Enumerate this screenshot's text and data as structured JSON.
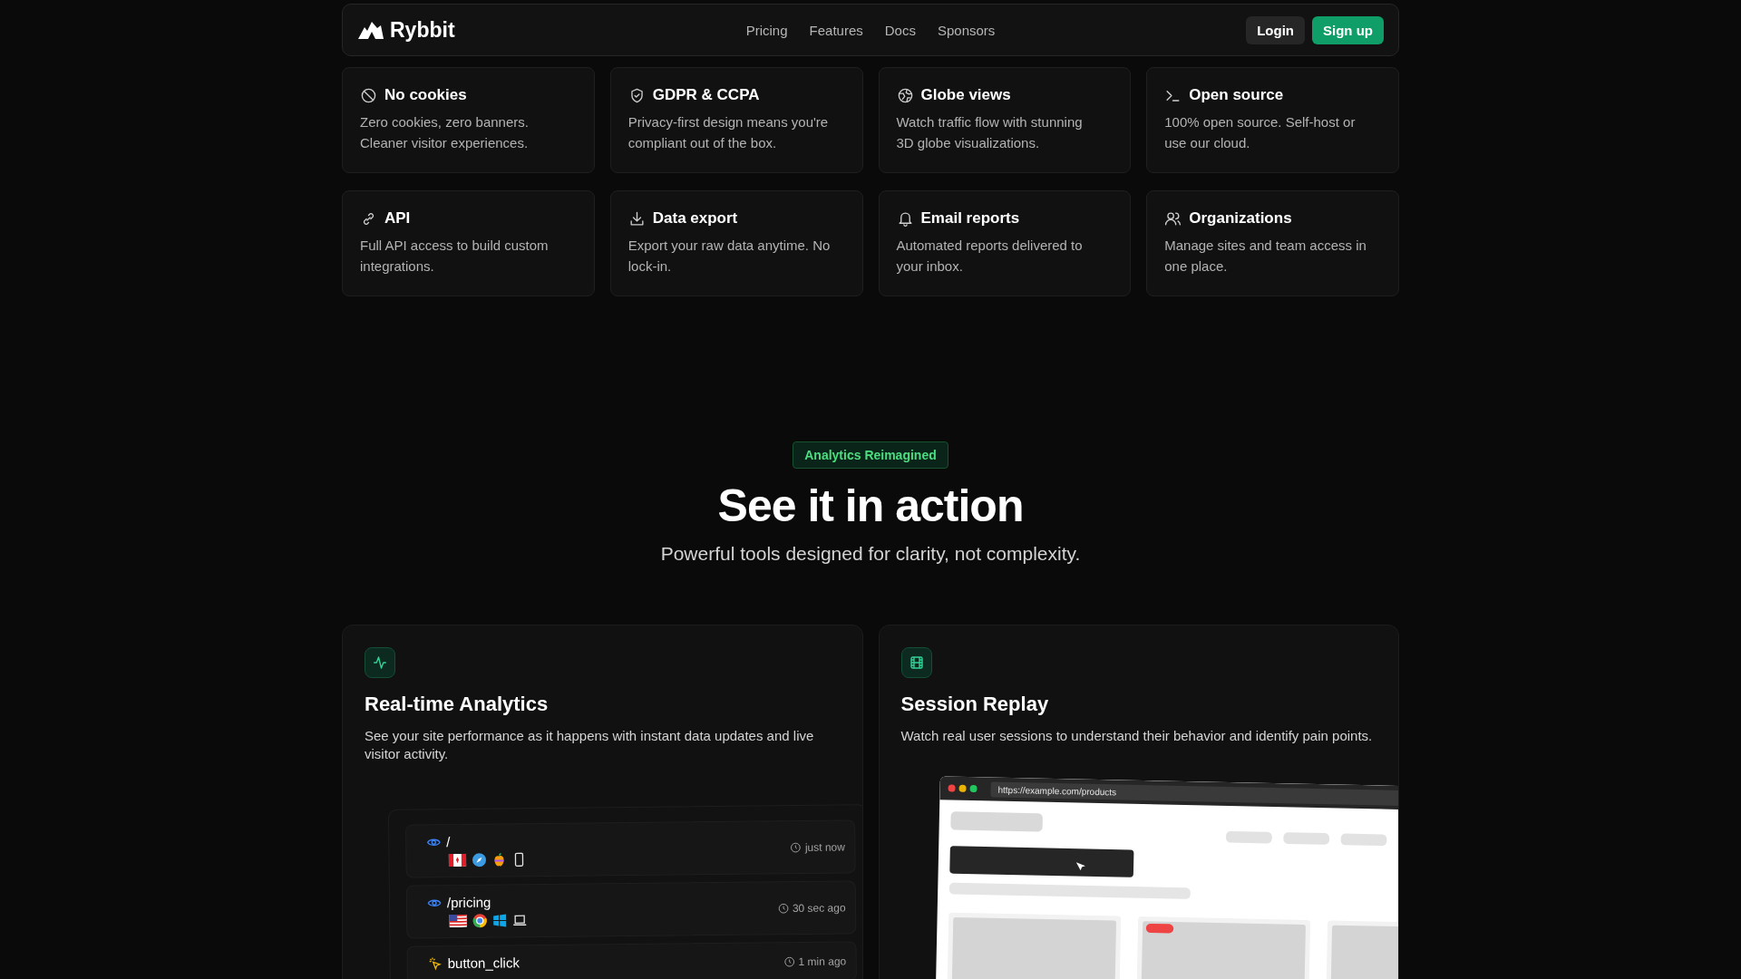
{
  "nav": {
    "logo": "Rybbit",
    "links": [
      "Pricing",
      "Features",
      "Docs",
      "Sponsors"
    ],
    "login": "Login",
    "signup": "Sign up"
  },
  "features": [
    {
      "kind": "ban",
      "title": "No cookies",
      "description": "Zero cookies, zero banners. Cleaner visitor experiences."
    },
    {
      "kind": "shield",
      "title": "GDPR & CCPA",
      "description": "Privacy-first design means you're compliant out of the box."
    },
    {
      "kind": "globe",
      "title": "Globe views",
      "description": "Watch traffic flow with stunning 3D globe visualizations."
    },
    {
      "kind": "terminal",
      "title": "Open source",
      "description": "100% open source. Self-host or use our cloud."
    },
    {
      "kind": "link",
      "title": "API",
      "description": "Full API access to build custom integrations."
    },
    {
      "kind": "download",
      "title": "Data export",
      "description": "Export your raw data anytime. No lock-in."
    },
    {
      "kind": "bell",
      "title": "Email reports",
      "description": "Automated reports delivered to your inbox."
    },
    {
      "kind": "users",
      "title": "Organizations",
      "description": "Manage sites and team access in one place."
    }
  ],
  "section": {
    "badge": "Analytics Reimagined",
    "title": "See it in action",
    "subtitle": "Powerful tools designed for clarity, not complexity."
  },
  "showcase": [
    {
      "kind": "analytics",
      "title": "Real-time Analytics",
      "description": "See your site performance as it happens with instant data updates and live visitor activity.",
      "events": [
        {
          "kind": "pageview",
          "label": "/",
          "time": "just now"
        },
        {
          "kind": "pageview",
          "label": "/pricing",
          "time": "30 sec ago"
        },
        {
          "kind": "event",
          "label": "button_click",
          "time": "1 min ago"
        }
      ]
    },
    {
      "kind": "replay",
      "title": "Session Replay",
      "description": "Watch real user sessions to understand their behavior and identify pain points.",
      "url": "https://example.com/products"
    }
  ]
}
